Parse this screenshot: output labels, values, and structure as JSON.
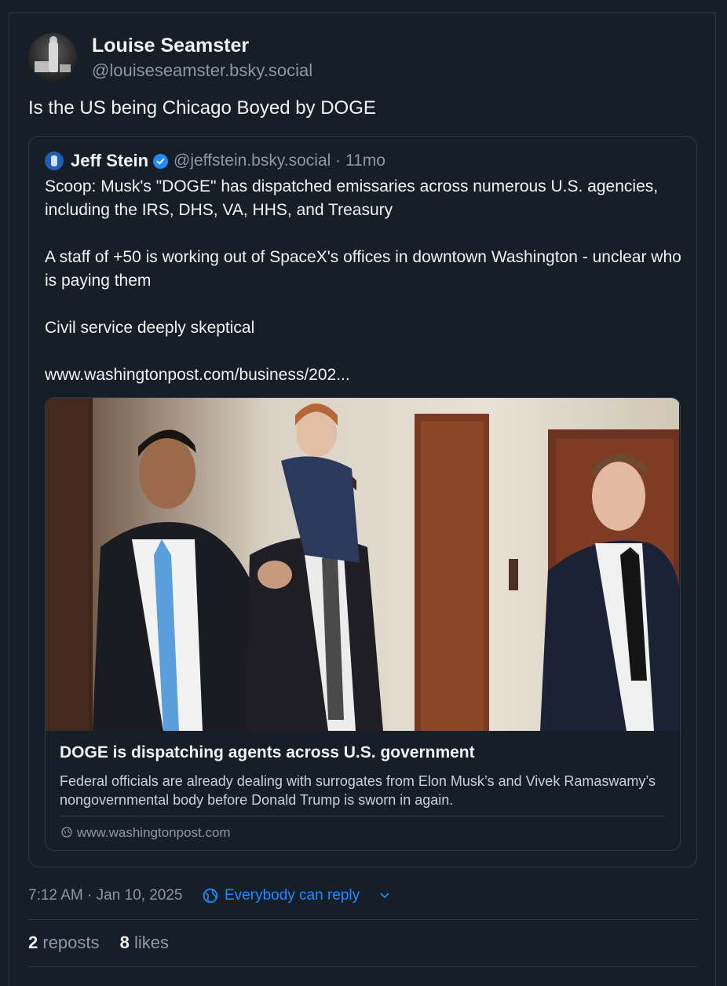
{
  "post": {
    "author_name": "Louise Seamster",
    "author_handle": "@louiseseamster.bsky.social",
    "text": "Is the US being Chicago Boyed by DOGE",
    "timestamp": "7:12 AM · Jan 10, 2025",
    "reply_setting": "Everybody can reply",
    "reposts_count": "2",
    "reposts_label": "reposts",
    "likes_count": "8",
    "likes_label": "likes"
  },
  "quote": {
    "author_name": "Jeff Stein",
    "handle_and_time": "@jeffstein.bsky.social · 11mo",
    "line1": "Scoop: Musk's \"DOGE\" has dispatched emissaries across numerous U.S. agencies, including the IRS, DHS, VA, HHS, and Treasury",
    "line2": "A staff of +50 is working out of SpaceX's offices in downtown Washington - unclear who is paying them",
    "line3": "Civil service deeply skeptical",
    "link": "www.washingtonpost.com/business/202..."
  },
  "link_card": {
    "title": "DOGE is dispatching agents across U.S. government",
    "description": "Federal officials are already dealing with surrogates from Elon Musk’s and Vivek Ramaswamy’s nongovernmental body before Donald Trump is sworn in again.",
    "domain": "www.washingtonpost.com"
  },
  "icons": {
    "verified": "verified-badge-icon",
    "reply_setting": "earth-icon",
    "dropdown": "chevron-down-icon",
    "domain": "globe-icon"
  },
  "colors": {
    "background": "#161e27",
    "accent": "#208bfe",
    "border": "#2e3a48",
    "muted_text": "#8b98a5"
  }
}
